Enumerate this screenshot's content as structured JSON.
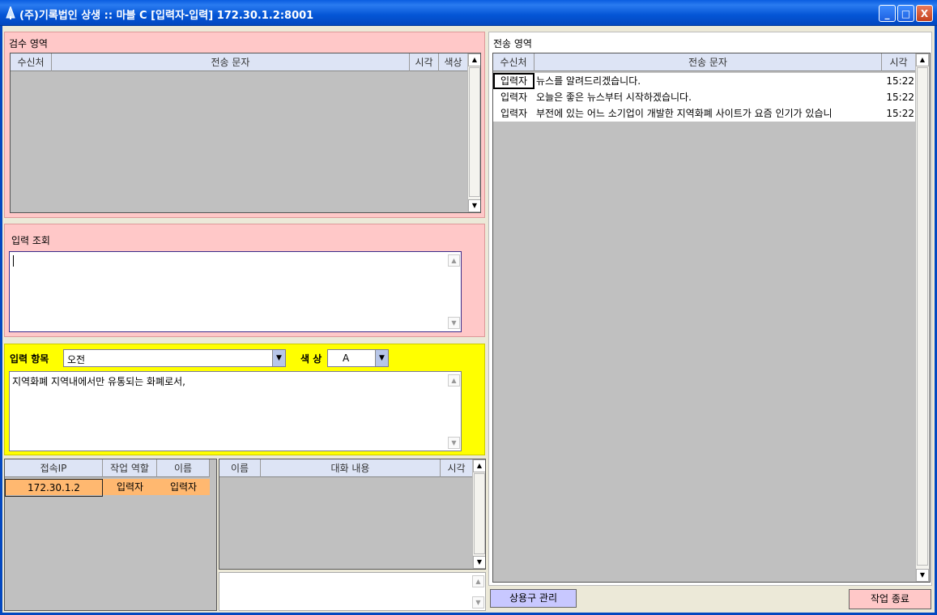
{
  "window": {
    "title": "(주)기록법인 상생 :: 마블 C [입력자-입력]  172.30.1.2:8001",
    "minimize": "_",
    "maximize": "□",
    "close": "X"
  },
  "review_area": {
    "title": "검수 영역",
    "columns": [
      "수신처",
      "전송 문자",
      "시각",
      "색상"
    ]
  },
  "input_view": {
    "title": "입력 조회",
    "text": ""
  },
  "input_item": {
    "label": "입력 항목",
    "selected": "오전",
    "color_label": "색 상",
    "color_selected": "A",
    "text": "지역화폐 지역내에서만 유통되는 화폐로서,"
  },
  "connection_table": {
    "columns": [
      "접속IP",
      "작업 역할",
      "이름"
    ],
    "rows": [
      {
        "ip": "172.30.1.2",
        "role": "입력자",
        "name": "입력자"
      }
    ]
  },
  "chat_table": {
    "columns": [
      "이름",
      "대화 내용",
      "시각"
    ]
  },
  "send_area": {
    "title": "전송 영역",
    "columns": [
      "수신처",
      "전송 문자",
      "시각"
    ],
    "rows": [
      {
        "to": "입력자",
        "msg": "뉴스를 알려드리겠습니다.",
        "time": "15:22"
      },
      {
        "to": "입력자",
        "msg": "오늘은 좋은 뉴스부터 시작하겠습니다.",
        "time": "15:22"
      },
      {
        "to": "입력자",
        "msg": "부전에 있는 어느 소기업이 개발한 지역화폐 사이트가 요즘 인기가 있습니",
        "time": "15:22"
      }
    ]
  },
  "buttons": {
    "phrase_manage": "상용구 관리",
    "end_work": "작업 종료"
  },
  "colors": {
    "pink_panel": "#ffc8c8",
    "yellow_panel": "#ffff00",
    "grid_bg": "#c0c0c0",
    "row_highlight": "#ffb870",
    "phrase_button": "#c8c8ff"
  }
}
